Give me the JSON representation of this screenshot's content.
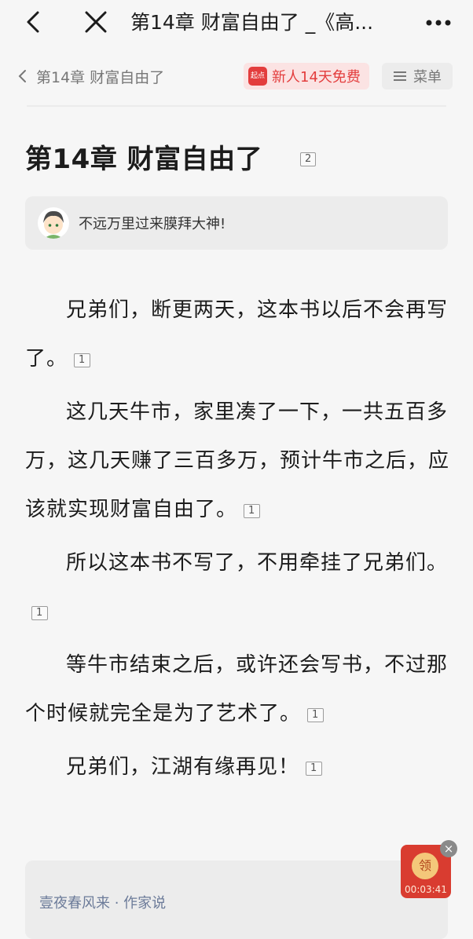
{
  "topbar": {
    "title": "第14章 财富自由了 _《高...",
    "back_icon": "chevron-left-icon",
    "close_icon": "close-icon",
    "more_icon": "more-dots-icon"
  },
  "readerbar": {
    "chapter_crumb": "第14章 财富自由了",
    "promo_logo": "起点",
    "promo_text": "新人14天免费",
    "menu_label": "菜单"
  },
  "chapter": {
    "title": "第14章 财富自由了",
    "comment_count": "2"
  },
  "comment": {
    "text": "不远万里过来膜拜大神!"
  },
  "paragraphs": [
    {
      "text": "兄弟们，断更两天，这本书以后不会再写了。",
      "count": "1"
    },
    {
      "text": "这几天牛市，家里凑了一下，一共五百多万，这几天赚了三百多万，预计牛市之后，应该就实现财富自由了。",
      "count": "1"
    },
    {
      "text": "所以这本书不写了，不用牵挂了兄弟们。",
      "count": "1"
    },
    {
      "text": "等牛市结束之后，或许还会写书，不过那个时候就完全是为了艺术了。",
      "count": "1"
    },
    {
      "text": "兄弟们，江湖有缘再见！",
      "count": "1"
    }
  ],
  "author_card": {
    "author": "壹夜春风来 · 作家说"
  },
  "redpacket": {
    "coin_label": "领",
    "timer": "00:03:41",
    "close": "×"
  },
  "colors": {
    "accent": "#e33d3d",
    "background": "#f6f6f6"
  }
}
